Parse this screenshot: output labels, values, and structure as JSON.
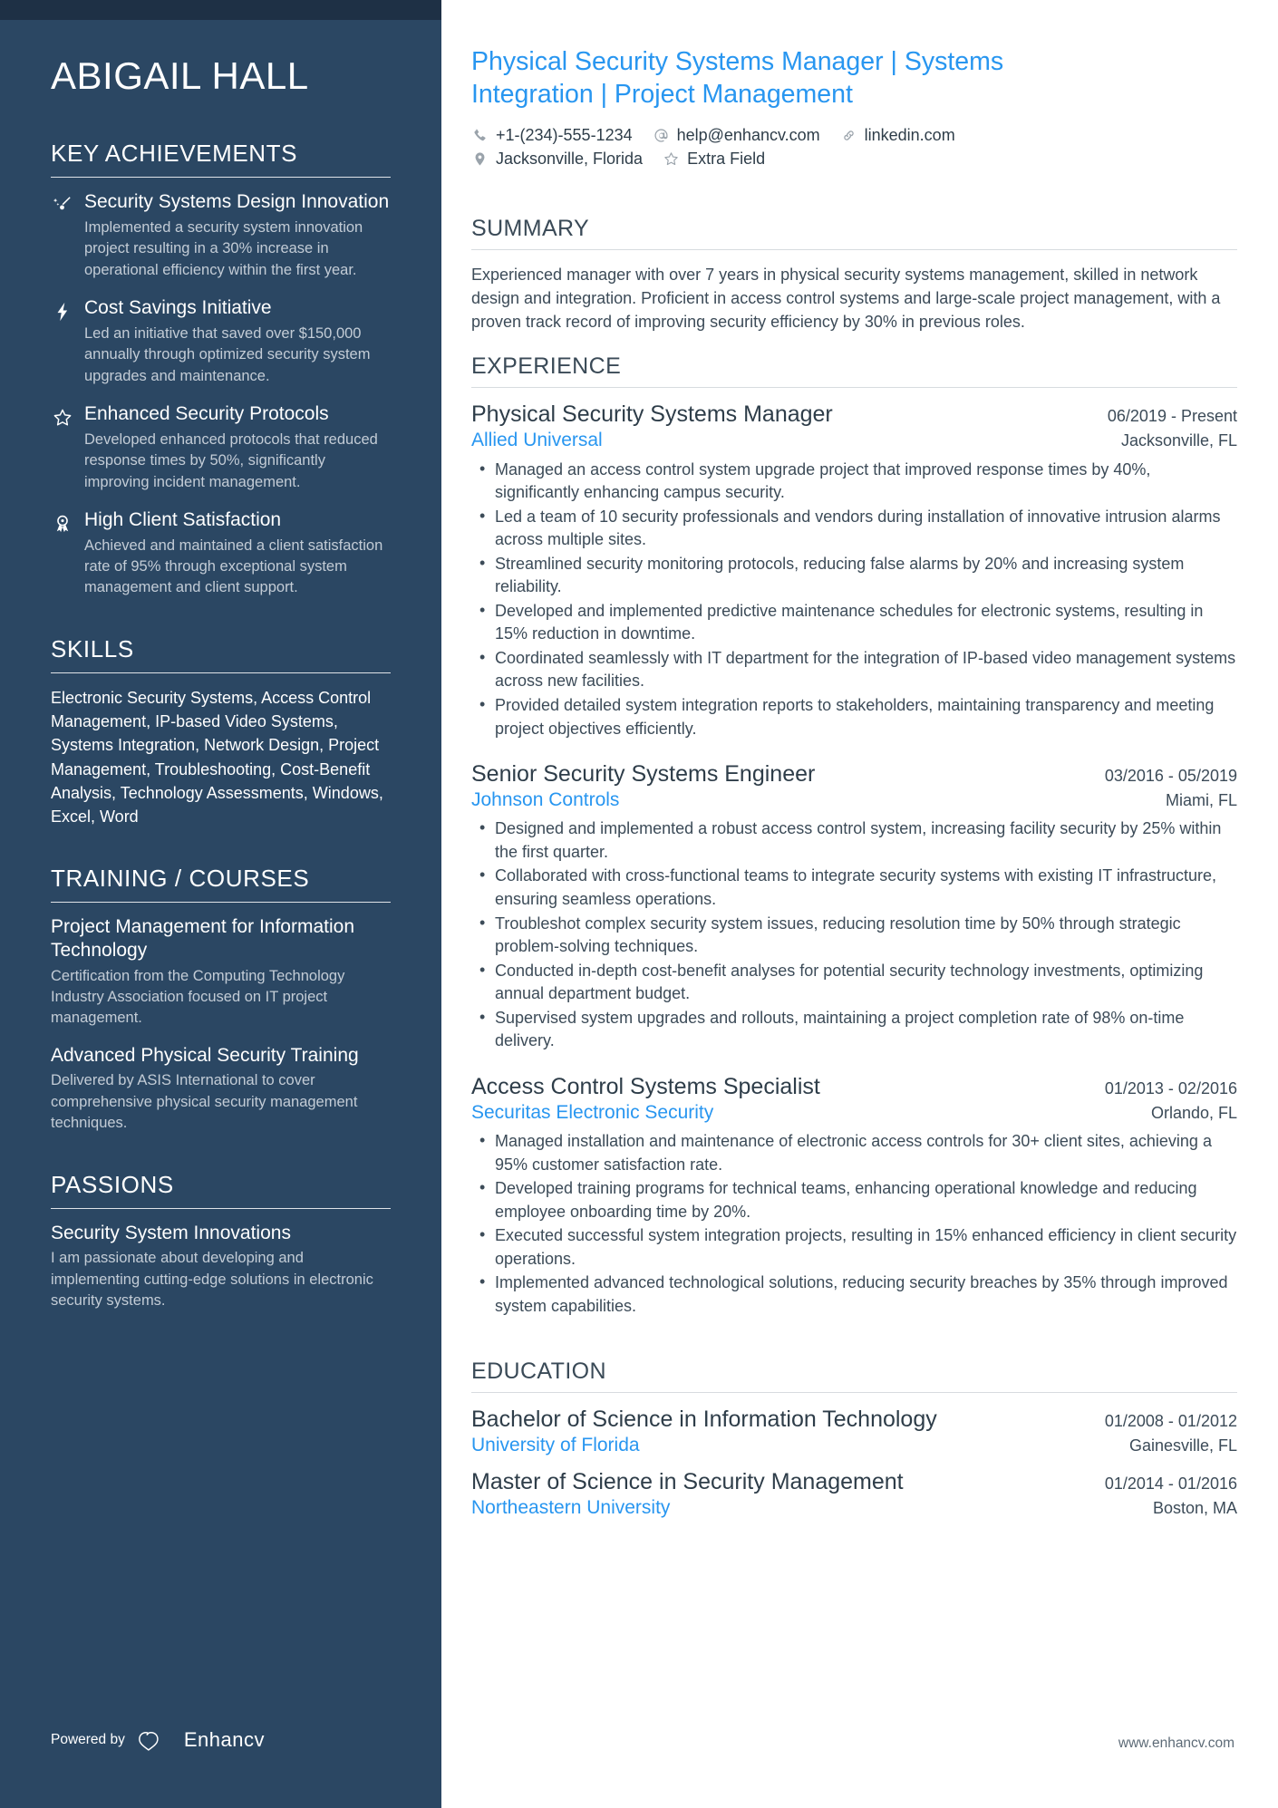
{
  "sidebar": {
    "name": "ABIGAIL HALL",
    "sections": {
      "achievements_heading": "KEY ACHIEVEMENTS",
      "skills_heading": "SKILLS",
      "training_heading": "TRAINING / COURSES",
      "passions_heading": "PASSIONS"
    },
    "achievements": [
      {
        "icon": "shooting-star-icon",
        "title": "Security Systems Design Innovation",
        "desc": "Implemented a security system innovation project resulting in a 30% increase in operational efficiency within the first year."
      },
      {
        "icon": "lightning-bolt-icon",
        "title": "Cost Savings Initiative",
        "desc": "Led an initiative that saved over $150,000 annually through optimized security system upgrades and maintenance."
      },
      {
        "icon": "star-icon",
        "title": "Enhanced Security Protocols",
        "desc": "Developed enhanced protocols that reduced response times by 50%, significantly improving incident management."
      },
      {
        "icon": "award-ribbon-icon",
        "title": "High Client Satisfaction",
        "desc": "Achieved and maintained a client satisfaction rate of 95% through exceptional system management and client support."
      }
    ],
    "skills_text": "Electronic Security Systems, Access Control Management, IP-based Video Systems, Systems Integration, Network Design, Project Management, Troubleshooting, Cost-Benefit Analysis, Technology Assessments, Windows, Excel, Word",
    "courses": [
      {
        "title": "Project Management for Information Technology",
        "desc": "Certification from the Computing Technology Industry Association focused on IT project management."
      },
      {
        "title": "Advanced Physical Security Training",
        "desc": "Delivered by ASIS International to cover comprehensive physical security management techniques."
      }
    ],
    "passions": [
      {
        "title": "Security System Innovations",
        "desc": "I am passionate about developing and implementing cutting-edge solutions in electronic security systems."
      }
    ],
    "footer": {
      "powered_by": "Powered by",
      "brand": "Enhancv"
    }
  },
  "main": {
    "headline": "Physical Security Systems Manager | Systems Integration | Project Management",
    "contacts_row1": [
      {
        "icon": "phone-icon",
        "text": "+1-(234)-555-1234"
      },
      {
        "icon": "at-sign-icon",
        "text": "help@enhancv.com"
      },
      {
        "icon": "link-icon",
        "text": "linkedin.com"
      }
    ],
    "contacts_row2": [
      {
        "icon": "location-pin-icon",
        "text": "Jacksonville, Florida"
      },
      {
        "icon": "star-outline-icon",
        "text": "Extra Field"
      }
    ],
    "summary_heading": "SUMMARY",
    "summary_text": "Experienced manager with over 7 years in physical security systems management, skilled in network design and integration. Proficient in access control systems and large-scale project management, with a proven track record of improving security efficiency by 30% in previous roles.",
    "experience_heading": "EXPERIENCE",
    "experience": [
      {
        "title": "Physical Security Systems Manager",
        "dates": "06/2019 - Present",
        "org": "Allied Universal",
        "location": "Jacksonville, FL",
        "bullets": [
          "Managed an access control system upgrade project that improved response times by 40%, significantly enhancing campus security.",
          "Led a team of 10 security professionals and vendors during installation of innovative intrusion alarms across multiple sites.",
          "Streamlined security monitoring protocols, reducing false alarms by 20% and increasing system reliability.",
          "Developed and implemented predictive maintenance schedules for electronic systems, resulting in 15% reduction in downtime.",
          "Coordinated seamlessly with IT department for the integration of IP-based video management systems across new facilities.",
          "Provided detailed system integration reports to stakeholders, maintaining transparency and meeting project objectives efficiently."
        ]
      },
      {
        "title": "Senior Security Systems Engineer",
        "dates": "03/2016 - 05/2019",
        "org": "Johnson Controls",
        "location": "Miami, FL",
        "bullets": [
          "Designed and implemented a robust access control system, increasing facility security by 25% within the first quarter.",
          "Collaborated with cross-functional teams to integrate security systems with existing IT infrastructure, ensuring seamless operations.",
          "Troubleshot complex security system issues, reducing resolution time by 50% through strategic problem-solving techniques.",
          "Conducted in-depth cost-benefit analyses for potential security technology investments, optimizing annual department budget.",
          "Supervised system upgrades and rollouts, maintaining a project completion rate of 98% on-time delivery."
        ]
      },
      {
        "title": "Access Control Systems Specialist",
        "dates": "01/2013 - 02/2016",
        "org": "Securitas Electronic Security",
        "location": "Orlando, FL",
        "bullets": [
          "Managed installation and maintenance of electronic access controls for 30+ client sites, achieving a 95% customer satisfaction rate.",
          "Developed training programs for technical teams, enhancing operational knowledge and reducing employee onboarding time by 20%.",
          "Executed successful system integration projects, resulting in 15% enhanced efficiency in client security operations.",
          "Implemented advanced technological solutions, reducing security breaches by 35% through improved system capabilities."
        ]
      }
    ],
    "education_heading": "EDUCATION",
    "education": [
      {
        "title": "Bachelor of Science in Information Technology",
        "dates": "01/2008 - 01/2012",
        "org": "University of Florida",
        "location": "Gainesville, FL"
      },
      {
        "title": "Master of Science in Security Management",
        "dates": "01/2014 - 01/2016",
        "org": "Northeastern University",
        "location": "Boston, MA"
      }
    ],
    "site_url": "www.enhancv.com"
  },
  "colors": {
    "sidebar_bg": "#2b4763",
    "sidebar_topbar": "#1e3045",
    "accent_blue": "#2896f0",
    "body_text": "#3c4b58"
  }
}
